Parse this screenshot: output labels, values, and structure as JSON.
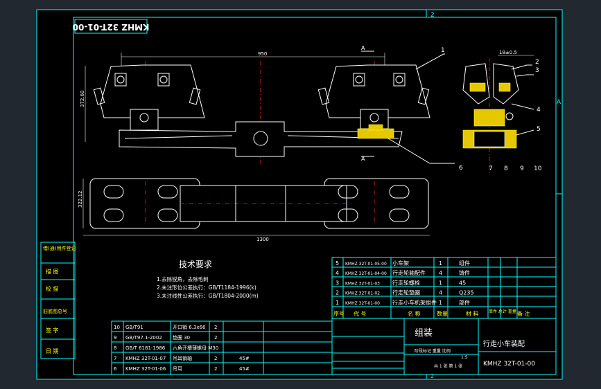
{
  "frame": {
    "zone_top": "2",
    "zone_bottom": "2",
    "zone_right": "A"
  },
  "drawing_number_box": "KMHZ 32T-01-00",
  "front_view": {
    "dim_width": "950",
    "dim_height": "372.60",
    "callouts": [
      "1",
      "6"
    ]
  },
  "top_view": {
    "dim_length": "1300",
    "dim_depth": "322.12"
  },
  "section_view": {
    "dim": "18±0.5",
    "callouts": [
      "2",
      "3",
      "4",
      "5",
      "7",
      "8",
      "9",
      "10"
    ]
  },
  "left_strip": [
    "借(通)用件登记",
    "描 图",
    "校 描",
    "旧底图总号",
    "签 字",
    "日 期"
  ],
  "tech_requirements": {
    "title": "技术要求",
    "lines": [
      "1.去除锐角，去除毛刺",
      "2.未注形位公差执行：GB/T1184-1996(k)",
      "3.未注线性公差执行：GB/T1804-2000(m)"
    ]
  },
  "parts_upper": [
    {
      "no": "5",
      "code": "KMHZ 32T-01-05-00",
      "name": "小车架",
      "qty": "1",
      "material": "组件"
    },
    {
      "no": "4",
      "code": "KMHZ 32T-01-04-00",
      "name": "行走轮轴配件",
      "qty": "4",
      "material": "铸件"
    },
    {
      "no": "3",
      "code": "KMHZ 32T-01-03",
      "name": "行走轮螺栓",
      "qty": "1",
      "material": "45"
    },
    {
      "no": "2",
      "code": "KMHZ 32T-01-02",
      "name": "行走轮垫圈",
      "qty": "4",
      "material": "Q235"
    },
    {
      "no": "1",
      "code": "KMHZ 32T-01-00",
      "name": "行走小车机架组件",
      "qty": "1",
      "material": "部件"
    }
  ],
  "parts_header": [
    "序号",
    "代 号",
    "名 称",
    "数量",
    "材 料",
    "单件 总计 重量",
    "备 注"
  ],
  "parts_lower": [
    {
      "no": "10",
      "code": "GB/T91",
      "name": "开口销 6.3x66",
      "qty": "2",
      "material": ""
    },
    {
      "no": "9",
      "code": "GB/T97.1-2002",
      "name": "垫圈 30",
      "qty": "2",
      "material": ""
    },
    {
      "no": "8",
      "code": "GB/T 6181-1986",
      "name": "六角开槽薄螺母 M30",
      "qty": "",
      "material": ""
    },
    {
      "no": "7",
      "code": "KMHZ 32T-01-07",
      "name": "吊耳销轴",
      "qty": "2",
      "material": "45#"
    },
    {
      "no": "6",
      "code": "KMHZ 32T-01-06",
      "name": "吊耳",
      "qty": "2",
      "material": "45#"
    }
  ],
  "title_block": {
    "assembly": "组装",
    "title": "行走小车装配",
    "number": "KMHZ 32T-01-00",
    "fields": "阶段标记  重量  比例",
    "scale": "1:5",
    "sheets": "共 1 张   第 1 张"
  }
}
